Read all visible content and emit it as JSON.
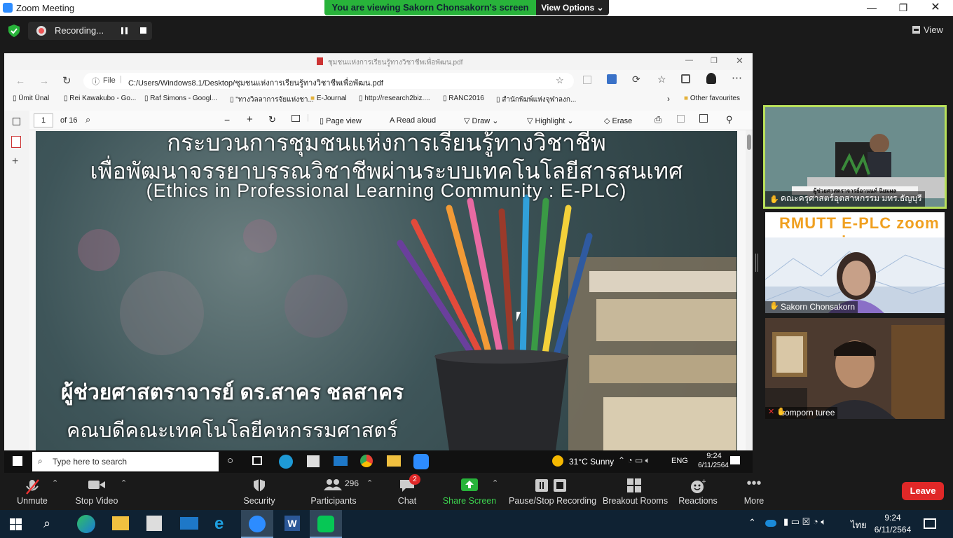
{
  "window": {
    "title": "Zoom Meeting",
    "viewing_banner": "You are viewing Sakorn  Chonsakorn's screen",
    "view_options": "View Options"
  },
  "meeting": {
    "recording_label": "Recording...",
    "view_label": "View"
  },
  "shared": {
    "edge_title": "ชุมชนแห่งการเรียนรู้ทางวิชาชีพเพื่อพัฒน.pdf",
    "address_prefix": "File",
    "address": "C:/Users/Windows8.1/Desktop/ชุมชนแห่งการเรียนรู้ทางวิชาชีพเพื่อพัฒน.pdf",
    "favorites": [
      "Ümit Ünal",
      "Rei Kawakubo - Go...",
      "Raf Simons - Googl...",
      "\"ทางวิลลาการจัยแห่งชา...",
      "E-Journal",
      "http://research2biz....",
      "RANC2016",
      "สำนักพิมพ์แห่งจุฬาลงก...",
      "Other favourites"
    ],
    "pdf_toolbar": {
      "page": "1",
      "of": "of 16",
      "page_view": "Page view",
      "read_aloud": "Read aloud",
      "draw": "Draw",
      "highlight": "Highlight",
      "erase": "Erase"
    },
    "slide": {
      "title1": "กระบวนการชุมชนแห่งการเรียนรู้ทางวิชาชีพ",
      "title2": "เพื่อพัฒนาจรรยาบรรณวิชาชีพผ่านระบบเทคโนโลยีสารสนเทศ",
      "title3": "(Ethics in Professional Learning Community : E-PLC)",
      "presenter": "ผู้ช่วยศาสตราจารย์ ดร.สาคร ชลสาคร",
      "position": "คณบดีคณะเทคโนโลยีคหกรรมศาสตร์"
    },
    "taskbar": {
      "search_placeholder": "Type here to search",
      "weather": "31°C  Sunny",
      "lang": "ENG",
      "time": "9:24",
      "date": "6/11/2564"
    }
  },
  "participants_video": [
    {
      "name": "คณะครุศาสตร์อุตสาหกรรม มทร.ธัญบุรี",
      "caption": "ผู้ช่วยศาสตราจารย์อานนท์ นิยมผล"
    },
    {
      "name": "Sakorn  Chonsakorn",
      "banner": "RMUTT E-PLC zoom symposium"
    },
    {
      "name": "somporn turee"
    }
  ],
  "toolbar": {
    "unmute": "Unmute",
    "stop_video": "Stop Video",
    "security": "Security",
    "participants": "Participants",
    "participants_count": "296",
    "chat": "Chat",
    "chat_badge": "2",
    "share_screen": "Share Screen",
    "pause_recording": "Pause/Stop Recording",
    "breakout": "Breakout Rooms",
    "reactions": "Reactions",
    "more": "More",
    "leave": "Leave"
  },
  "win_taskbar": {
    "time": "9:24",
    "date": "6/11/2564",
    "lang": "ไทย"
  },
  "colors": {
    "zoom_blue": "#2d8cff",
    "green": "#28b33a",
    "leave_red": "#e02828"
  }
}
